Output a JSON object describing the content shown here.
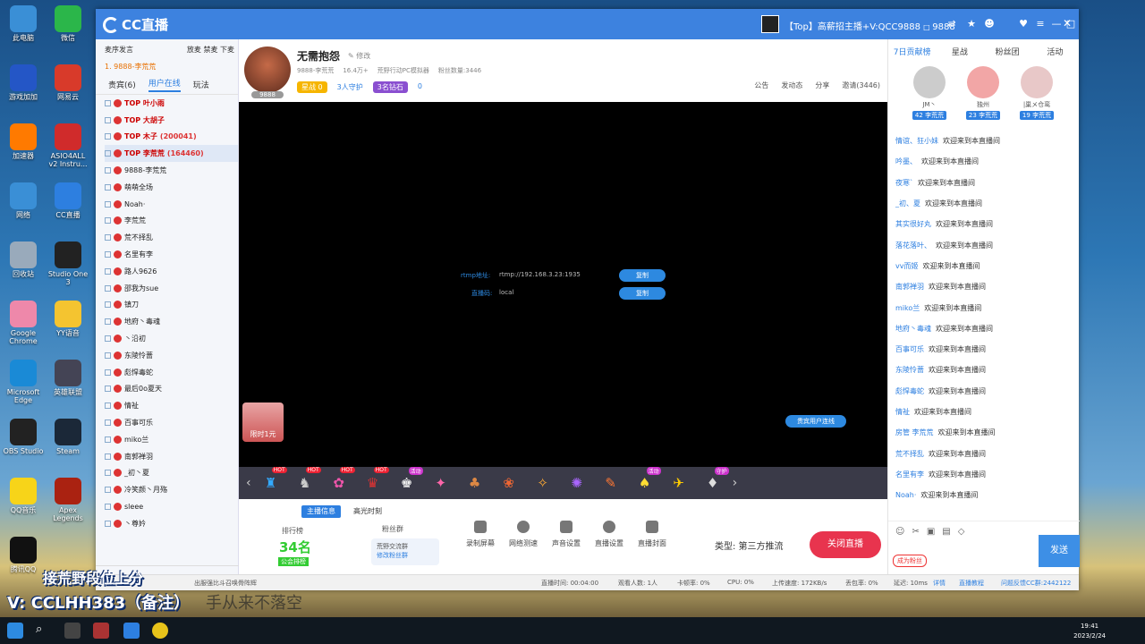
{
  "desktop": {
    "icons": [
      {
        "label": "此电脑",
        "color": "#3a8fd6"
      },
      {
        "label": "微信",
        "color": "#2bb64a"
      },
      {
        "label": "游戏加加",
        "color": "#2456c6"
      },
      {
        "label": "网易云",
        "color": "#d83a2a"
      },
      {
        "label": "加速器",
        "color": "#ff7a00"
      },
      {
        "label": "ASIO4ALL v2 Instru...",
        "color": "#d02b2b"
      },
      {
        "label": "网络",
        "color": "#3a8fd6"
      },
      {
        "label": "CC直播",
        "color": "#2d7fe0"
      },
      {
        "label": "回收站",
        "color": "#9ab"
      },
      {
        "label": "Studio One 3",
        "color": "#222"
      },
      {
        "label": "Google Chrome",
        "color": "#e8a"
      },
      {
        "label": "YY语音",
        "color": "#f4c430"
      },
      {
        "label": "Microsoft Edge",
        "color": "#1a8ad6"
      },
      {
        "label": "英雄联盟",
        "color": "#445"
      },
      {
        "label": "OBS Studio",
        "color": "#222"
      },
      {
        "label": "Steam",
        "color": "#1b2838"
      },
      {
        "label": "QQ音乐",
        "color": "#f7d419"
      },
      {
        "label": "Apex Legends",
        "color": "#a21"
      },
      {
        "label": "腾讯QQ",
        "color": "#111"
      }
    ]
  },
  "window": {
    "app_name": "CC直播",
    "title_text": "【Top】高薪招主播+V:QCC9888",
    "title_id": "9888"
  },
  "queue": {
    "label": "麦序发言",
    "right": "放麦 禁麦 下麦",
    "first": "1. 9888-李荒荒"
  },
  "left_tabs": [
    "贵宾(6)",
    "用户在线",
    "玩法"
  ],
  "users": [
    {
      "name": "TOP 叶小雨",
      "extra": "",
      "cls": "top"
    },
    {
      "name": "TOP 大胡子",
      "extra": "",
      "cls": "top"
    },
    {
      "name": "TOP 木子",
      "extra": "(200041)",
      "cls": "top"
    },
    {
      "name": "TOP 李荒荒",
      "extra": "(164460)",
      "cls": "top sel"
    },
    {
      "name": "9888-李荒荒",
      "extra": "",
      "cls": ""
    },
    {
      "name": "萌萌全场",
      "extra": "",
      "cls": ""
    },
    {
      "name": "Noah·",
      "extra": "",
      "cls": ""
    },
    {
      "name": "李荒荒",
      "extra": "",
      "cls": ""
    },
    {
      "name": "荒不择乱",
      "extra": "",
      "cls": ""
    },
    {
      "name": "名里有李",
      "extra": "",
      "cls": ""
    },
    {
      "name": "路人9626",
      "extra": "",
      "cls": ""
    },
    {
      "name": "邵我为sue",
      "extra": "",
      "cls": ""
    },
    {
      "name": "镇刀",
      "extra": "",
      "cls": ""
    },
    {
      "name": "地府丶毒魂",
      "extra": "",
      "cls": ""
    },
    {
      "name": "丶沿初",
      "extra": "",
      "cls": ""
    },
    {
      "name": "东陵怜蔷",
      "extra": "",
      "cls": ""
    },
    {
      "name": "彪悍毒蛇",
      "extra": "",
      "cls": ""
    },
    {
      "name": "最后0o夏天",
      "extra": "",
      "cls": ""
    },
    {
      "name": "情祉",
      "extra": "",
      "cls": ""
    },
    {
      "name": "百事可乐",
      "extra": "",
      "cls": ""
    },
    {
      "name": "miko兰",
      "extra": "",
      "cls": ""
    },
    {
      "name": "南郭禅羽",
      "extra": "",
      "cls": ""
    },
    {
      "name": "_初丶夏",
      "extra": "",
      "cls": ""
    },
    {
      "name": "冷笑颜丶月殇",
      "extra": "",
      "cls": ""
    },
    {
      "name": "sleee",
      "extra": "",
      "cls": ""
    },
    {
      "name": "丶尊妗",
      "extra": "",
      "cls": ""
    }
  ],
  "streamer": {
    "name": "无需抱怨",
    "edit": "修改",
    "room_id": "9888",
    "meta": [
      "9888-李荒荒",
      "16.4万+",
      "荒野行动PC模拟器",
      "粉丝数量:3446"
    ],
    "star": "星战",
    "star_count": "0",
    "guards": "3人守护",
    "diamonds": "3名钻石",
    "count": "0",
    "actions": [
      "公告",
      "发动态",
      "分享",
      "邀请(3446)"
    ]
  },
  "video": {
    "rtmp_label": "rtmp地址:",
    "rtmp_value": "rtmp://192.168.3.23:1935",
    "key_label": "直播码:",
    "key_value": "local",
    "copy": "复制",
    "gift_text": "限时1元",
    "vip_link": "贵宾用户连线"
  },
  "giftbar": {
    "tags": [
      "HOT",
      "HOT",
      "HOT",
      "HOT",
      "活动",
      "",
      "",
      "",
      "",
      "",
      "",
      "活动",
      "",
      "守护"
    ]
  },
  "bottom": {
    "tab1": "主播信息",
    "tab2": "高光时刻",
    "rank_label": "排行榜",
    "rank_num": "34名",
    "rank_sub": "公会排榜",
    "fans_label": "粉丝群",
    "fans_text": "荒野交流群",
    "fans_link": "修改粉丝群",
    "tools": [
      "录制屏幕",
      "网络测速",
      "声音设置",
      "直播设置",
      "直播封面"
    ],
    "type_label": "类型:  第三方推流",
    "close_live": "关闭直播"
  },
  "status": {
    "hint": "出服强比斗召唤骨阵辉",
    "live_time": "直播时间: 00:04:00",
    "viewers": "观看人数: 1人",
    "lag": "卡顿率: 0%",
    "cpu": "CPU: 0%",
    "upload": "上传速度: 172KB/s",
    "loss": "丢包率: 0%",
    "delay": "延迟: 10ms",
    "detail": "详情",
    "tutorial": "直播教程",
    "feedback": "问题反馈CC群:2442122"
  },
  "right_tabs": [
    "7日贡献榜",
    "星战",
    "粉丝团",
    "活动"
  ],
  "top3": [
    {
      "name": "JM丶",
      "badge": "李荒荒",
      "lvl": "42"
    },
    {
      "name": "独州",
      "badge": "李荒荒",
      "lvl": "23"
    },
    {
      "name": "|巢メ仓鸾",
      "badge": "李荒荒",
      "lvl": "19"
    }
  ],
  "chat": [
    {
      "name": "情谊、狂小妹",
      "text": "欢迎来到本直播间"
    },
    {
      "name": "吟墨、",
      "text": "欢迎来到本直播间"
    },
    {
      "name": "夜寒`",
      "text": "欢迎来到本直播间"
    },
    {
      "name": "_初、夏",
      "text": "欢迎来到本直播间"
    },
    {
      "name": "其实很好丸",
      "text": "欢迎来到本直播间"
    },
    {
      "name": "落花落叶、",
      "text": "欢迎来到本直播间"
    },
    {
      "name": "vv而姬",
      "text": "欢迎来到本直播间"
    },
    {
      "name": "南郭禅羽",
      "text": "欢迎来到本直播间"
    },
    {
      "name": "miko兰",
      "text": "欢迎来到本直播间"
    },
    {
      "name": "地府丶毒魂",
      "text": "欢迎来到本直播间"
    },
    {
      "name": "百事可乐",
      "text": "欢迎来到本直播间"
    },
    {
      "name": "东陵怜蔷",
      "text": "欢迎来到本直播间"
    },
    {
      "name": "彪悍毒蛇",
      "text": "欢迎来到本直播间"
    },
    {
      "name": "情祉",
      "text": "欢迎来到本直播间"
    },
    {
      "name": "房管 李荒荒",
      "text": "欢迎来到本直播间"
    },
    {
      "name": "荒不择乱",
      "text": "欢迎来到本直播间"
    },
    {
      "name": "名里有李",
      "text": "欢迎来到本直播间"
    },
    {
      "name": "Noah·",
      "text": "欢迎来到本直播间"
    }
  ],
  "chat_foot": {
    "reward": "成为粉丝",
    "send": "发送"
  },
  "taskbar": {
    "time": "19:41",
    "date": "2023/2/24"
  },
  "overlay": {
    "line1": "接荒野段位上分",
    "line2": "V: CCLHH383（备注）",
    "line3": "手从来不落空"
  }
}
